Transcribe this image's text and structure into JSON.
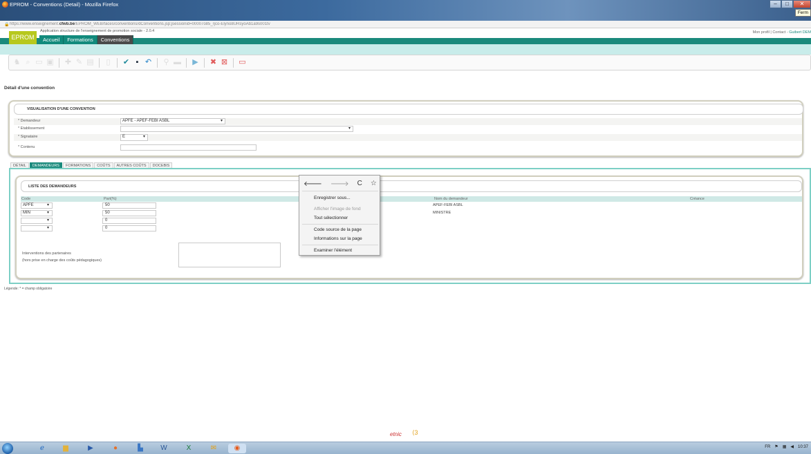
{
  "window": {
    "title": "EPROM - Conventions (Detail) - Mozilla Firefox",
    "tooltip": "Ferm",
    "minimize": "–",
    "maximize": "□",
    "close": "✕"
  },
  "browser": {
    "url_prefix": "https://www.enseignement.",
    "url_domain": "cfwb.be",
    "url_rest": "/EPROM_WEB/faces/conventions/dConventions.jsp;jsessionid=00007o85_rjco-Elyno8URsyoAb1a9s001tv"
  },
  "app": {
    "logo": "EPROM",
    "subtitle": "Application structure de l'enseignement de promotion sociale - 2.0.4",
    "nav": [
      "Accueil",
      "Formations",
      "Conventions"
    ],
    "top_links": {
      "profile": "Mon profil",
      "sep": "|",
      "contact": "Contact",
      "dash": "-",
      "user": "Guibert DEM"
    }
  },
  "page": {
    "title": "Détail d'une convention",
    "section_title": "VISUALISATION D'UNE CONVENTION",
    "fields": {
      "demandeur_label": "Demandeur",
      "demandeur_value": "APFE - APEF-FEBI ASBL",
      "etablissement_label": "Etablissement",
      "etablissement_value": "",
      "signataire_label": "Signataire",
      "signataire_value": "E",
      "contenu_label": "Contenu",
      "contenu_value": ""
    },
    "tabs": [
      "DÉTAIL",
      "DEMANDEURS",
      "FORMATIONS",
      "COÛTS",
      "AUTRES COÛTS",
      "DOCEBIS"
    ],
    "active_tab": "DEMANDEURS",
    "list_title": "LISTE DES DEMANDEURS",
    "columns": {
      "code": "Code",
      "part": "Part(%)",
      "nom": "Nom du demandeur",
      "creance": "Créance"
    },
    "rows": [
      {
        "code": "APFE",
        "part": "50",
        "nom": "APEF-FEBI ASBL"
      },
      {
        "code": "MIN",
        "part": "50",
        "nom": "MINISTRE"
      },
      {
        "code": "",
        "part": "0",
        "nom": ""
      },
      {
        "code": "",
        "part": "0",
        "nom": ""
      }
    ],
    "interventions_line1": "Interventions des partenaires",
    "interventions_line2": "(hors prise en charge des coûts pédagogiques)",
    "legend": "Légende:   * = champ obligatoire",
    "footer_brand": "etnic",
    "footer_mark": "⟨3"
  },
  "context_menu": {
    "nav_back": "🡐",
    "nav_forward": "🡒",
    "nav_reload": "C",
    "nav_bookmark": "☆",
    "items": [
      "Enregistrer sous...",
      "Afficher l'image de fond",
      "Tout sélectionner",
      "Code source de la page",
      "Informations sur la page",
      "Examiner l'élément"
    ]
  },
  "taskbar": {
    "lang": "FR",
    "time": "10:37"
  },
  "colors": {
    "teal": "#1a8a7c",
    "logo_green": "#b7c81d",
    "light_teal": "#c8ecea"
  }
}
